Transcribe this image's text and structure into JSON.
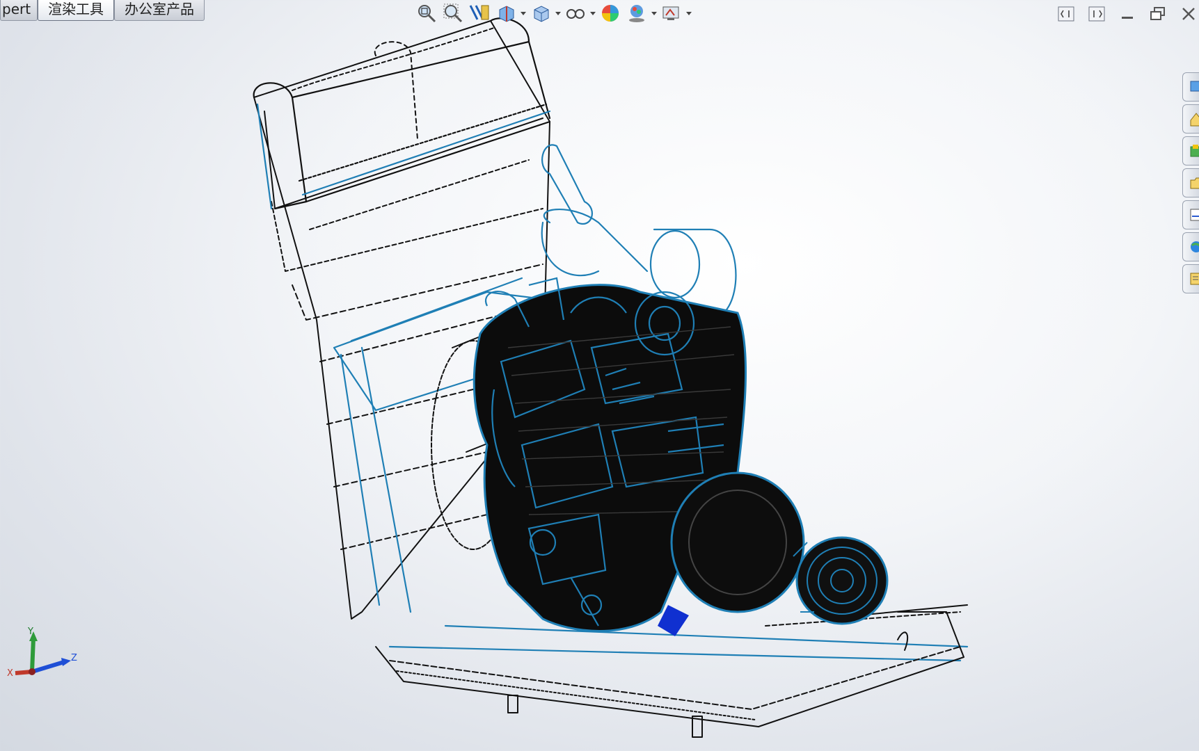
{
  "command_tabs": [
    {
      "label": "pert",
      "active": false
    },
    {
      "label": "渲染工具",
      "active": true
    },
    {
      "label": "办公室产品",
      "active": false
    }
  ],
  "heads_up_toolbar": [
    {
      "icon": "zoom-to-fit-icon"
    },
    {
      "icon": "zoom-to-area-icon"
    },
    {
      "icon": "previous-view-icon"
    },
    {
      "icon": "section-view-icon"
    },
    {
      "icon": "view-orientation-icon",
      "dropdown": true
    },
    {
      "icon": "display-style-icon",
      "dropdown": true
    },
    {
      "icon": "hide-show-items-icon",
      "dropdown": true
    },
    {
      "icon": "edit-appearance-icon"
    },
    {
      "icon": "apply-scene-icon",
      "dropdown": true
    },
    {
      "icon": "view-settings-icon",
      "dropdown": true
    }
  ],
  "window_controls": [
    "tile-left-icon",
    "tile-right-icon",
    "minimize-icon",
    "restore-icon",
    "close-icon"
  ],
  "task_pane": [
    "solidworks-resources-icon",
    "design-library-icon",
    "file-explorer-icon",
    "view-palette-icon",
    "appearances-icon",
    "custom-properties-icon",
    "file-properties-icon"
  ],
  "triad": {
    "x": "X",
    "y": "Y",
    "z": "Z"
  },
  "colors": {
    "edge_black": "#111111",
    "edge_blue": "#1f7fb5",
    "background": "#eef1f5"
  }
}
